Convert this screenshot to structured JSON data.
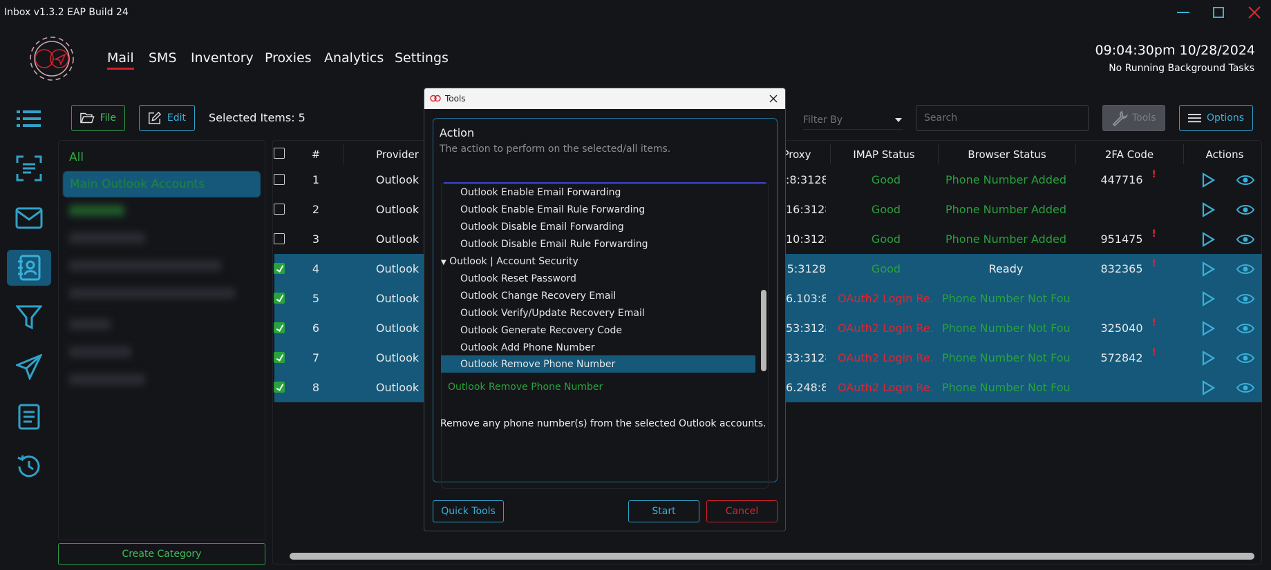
{
  "window": {
    "title": "Inbox v1.3.2 EAP Build 24"
  },
  "colors": {
    "accent_blue": "#3ab0d8",
    "accent_green": "#28a33a",
    "accent_red": "#e3242d",
    "selection": "#15587a"
  },
  "nav": {
    "mail": "Mail",
    "sms": "SMS",
    "inventory": "Inventory",
    "proxies": "Proxies",
    "analytics": "Analytics",
    "settings": "Settings"
  },
  "header": {
    "clock": "09:04:30pm 10/28/2024",
    "status": "No Running Background Tasks"
  },
  "sidebar_icons": [
    "list-icon",
    "scan-icon",
    "mail-icon",
    "contacts-icon",
    "filter-icon",
    "send-icon",
    "book-icon",
    "history-icon"
  ],
  "toolbar": {
    "file_label": "File",
    "edit_label": "Edit",
    "selected_items": "Selected Items: 5",
    "filter_placeholder": "Filter By",
    "search_placeholder": "Search",
    "tools_label": "Tools",
    "options_label": "Options"
  },
  "categories": {
    "all_label": "All",
    "main_label": "Main Outlook Accounts",
    "create_label": "Create Category"
  },
  "table": {
    "headers": {
      "num": "#",
      "provider": "Provider",
      "proxy": "Proxy",
      "imap": "IMAP Status",
      "browser": "Browser Status",
      "twofa": "2FA Code",
      "actions": "Actions"
    },
    "rows": [
      {
        "num": "1",
        "provider": "Outlook",
        "proxy": ":8:3128",
        "imap": "Good",
        "browser": "Phone Number Added",
        "twofa": "447716",
        "selected": false
      },
      {
        "num": "2",
        "provider": "Outlook",
        "proxy": "16:3128",
        "imap": "Good",
        "browser": "Phone Number Added",
        "twofa": "",
        "selected": false
      },
      {
        "num": "3",
        "provider": "Outlook",
        "proxy": "10:3128",
        "imap": "Good",
        "browser": "Phone Number Added",
        "twofa": "951475",
        "selected": false
      },
      {
        "num": "4",
        "provider": "Outlook",
        "proxy": "5:3128",
        "imap": "Good",
        "browser": "Ready",
        "twofa": "832365",
        "selected": true
      },
      {
        "num": "5",
        "provider": "Outlook",
        "proxy": "6.103:8...",
        "imap": "OAuth2 Login Re...",
        "browser": "Phone Number Not Fou...",
        "twofa": "",
        "selected": true
      },
      {
        "num": "6",
        "provider": "Outlook",
        "proxy": "53:3128",
        "imap": "OAuth2 Login Re...",
        "browser": "Phone Number Not Fou...",
        "twofa": "325040",
        "selected": true
      },
      {
        "num": "7",
        "provider": "Outlook",
        "proxy": "33:3128",
        "imap": "OAuth2 Login Re...",
        "browser": "Phone Number Not Fou...",
        "twofa": "572842",
        "selected": true
      },
      {
        "num": "8",
        "provider": "Outlook",
        "proxy": "6.248:8...",
        "imap": "OAuth2 Login Re...",
        "browser": "Phone Number Not Fou...",
        "twofa": "",
        "selected": true
      }
    ]
  },
  "modal": {
    "title": "Tools",
    "action_label": "Action",
    "action_desc": "The action to perform on the selected/all items.",
    "options": [
      "Outlook Enable Email Forwarding",
      "Outlook Enable Email Rule Forwarding",
      "Outlook Disable Email Forwarding",
      "Outlook Disable Email Rule Forwarding"
    ],
    "group_label": "Outlook | Account Security",
    "group_options": [
      "Outlook Reset Password",
      "Outlook Change Recovery Email",
      "Outlook Verify/Update Recovery Email",
      "Outlook Generate Recovery Code",
      "Outlook Add Phone Number",
      "Outlook Remove Phone Number"
    ],
    "current_value": "Outlook Remove Phone Number",
    "description": "Remove any phone number(s) from the selected Outlook accounts.",
    "quick_tools_label": "Quick Tools",
    "start_label": "Start",
    "cancel_label": "Cancel"
  }
}
